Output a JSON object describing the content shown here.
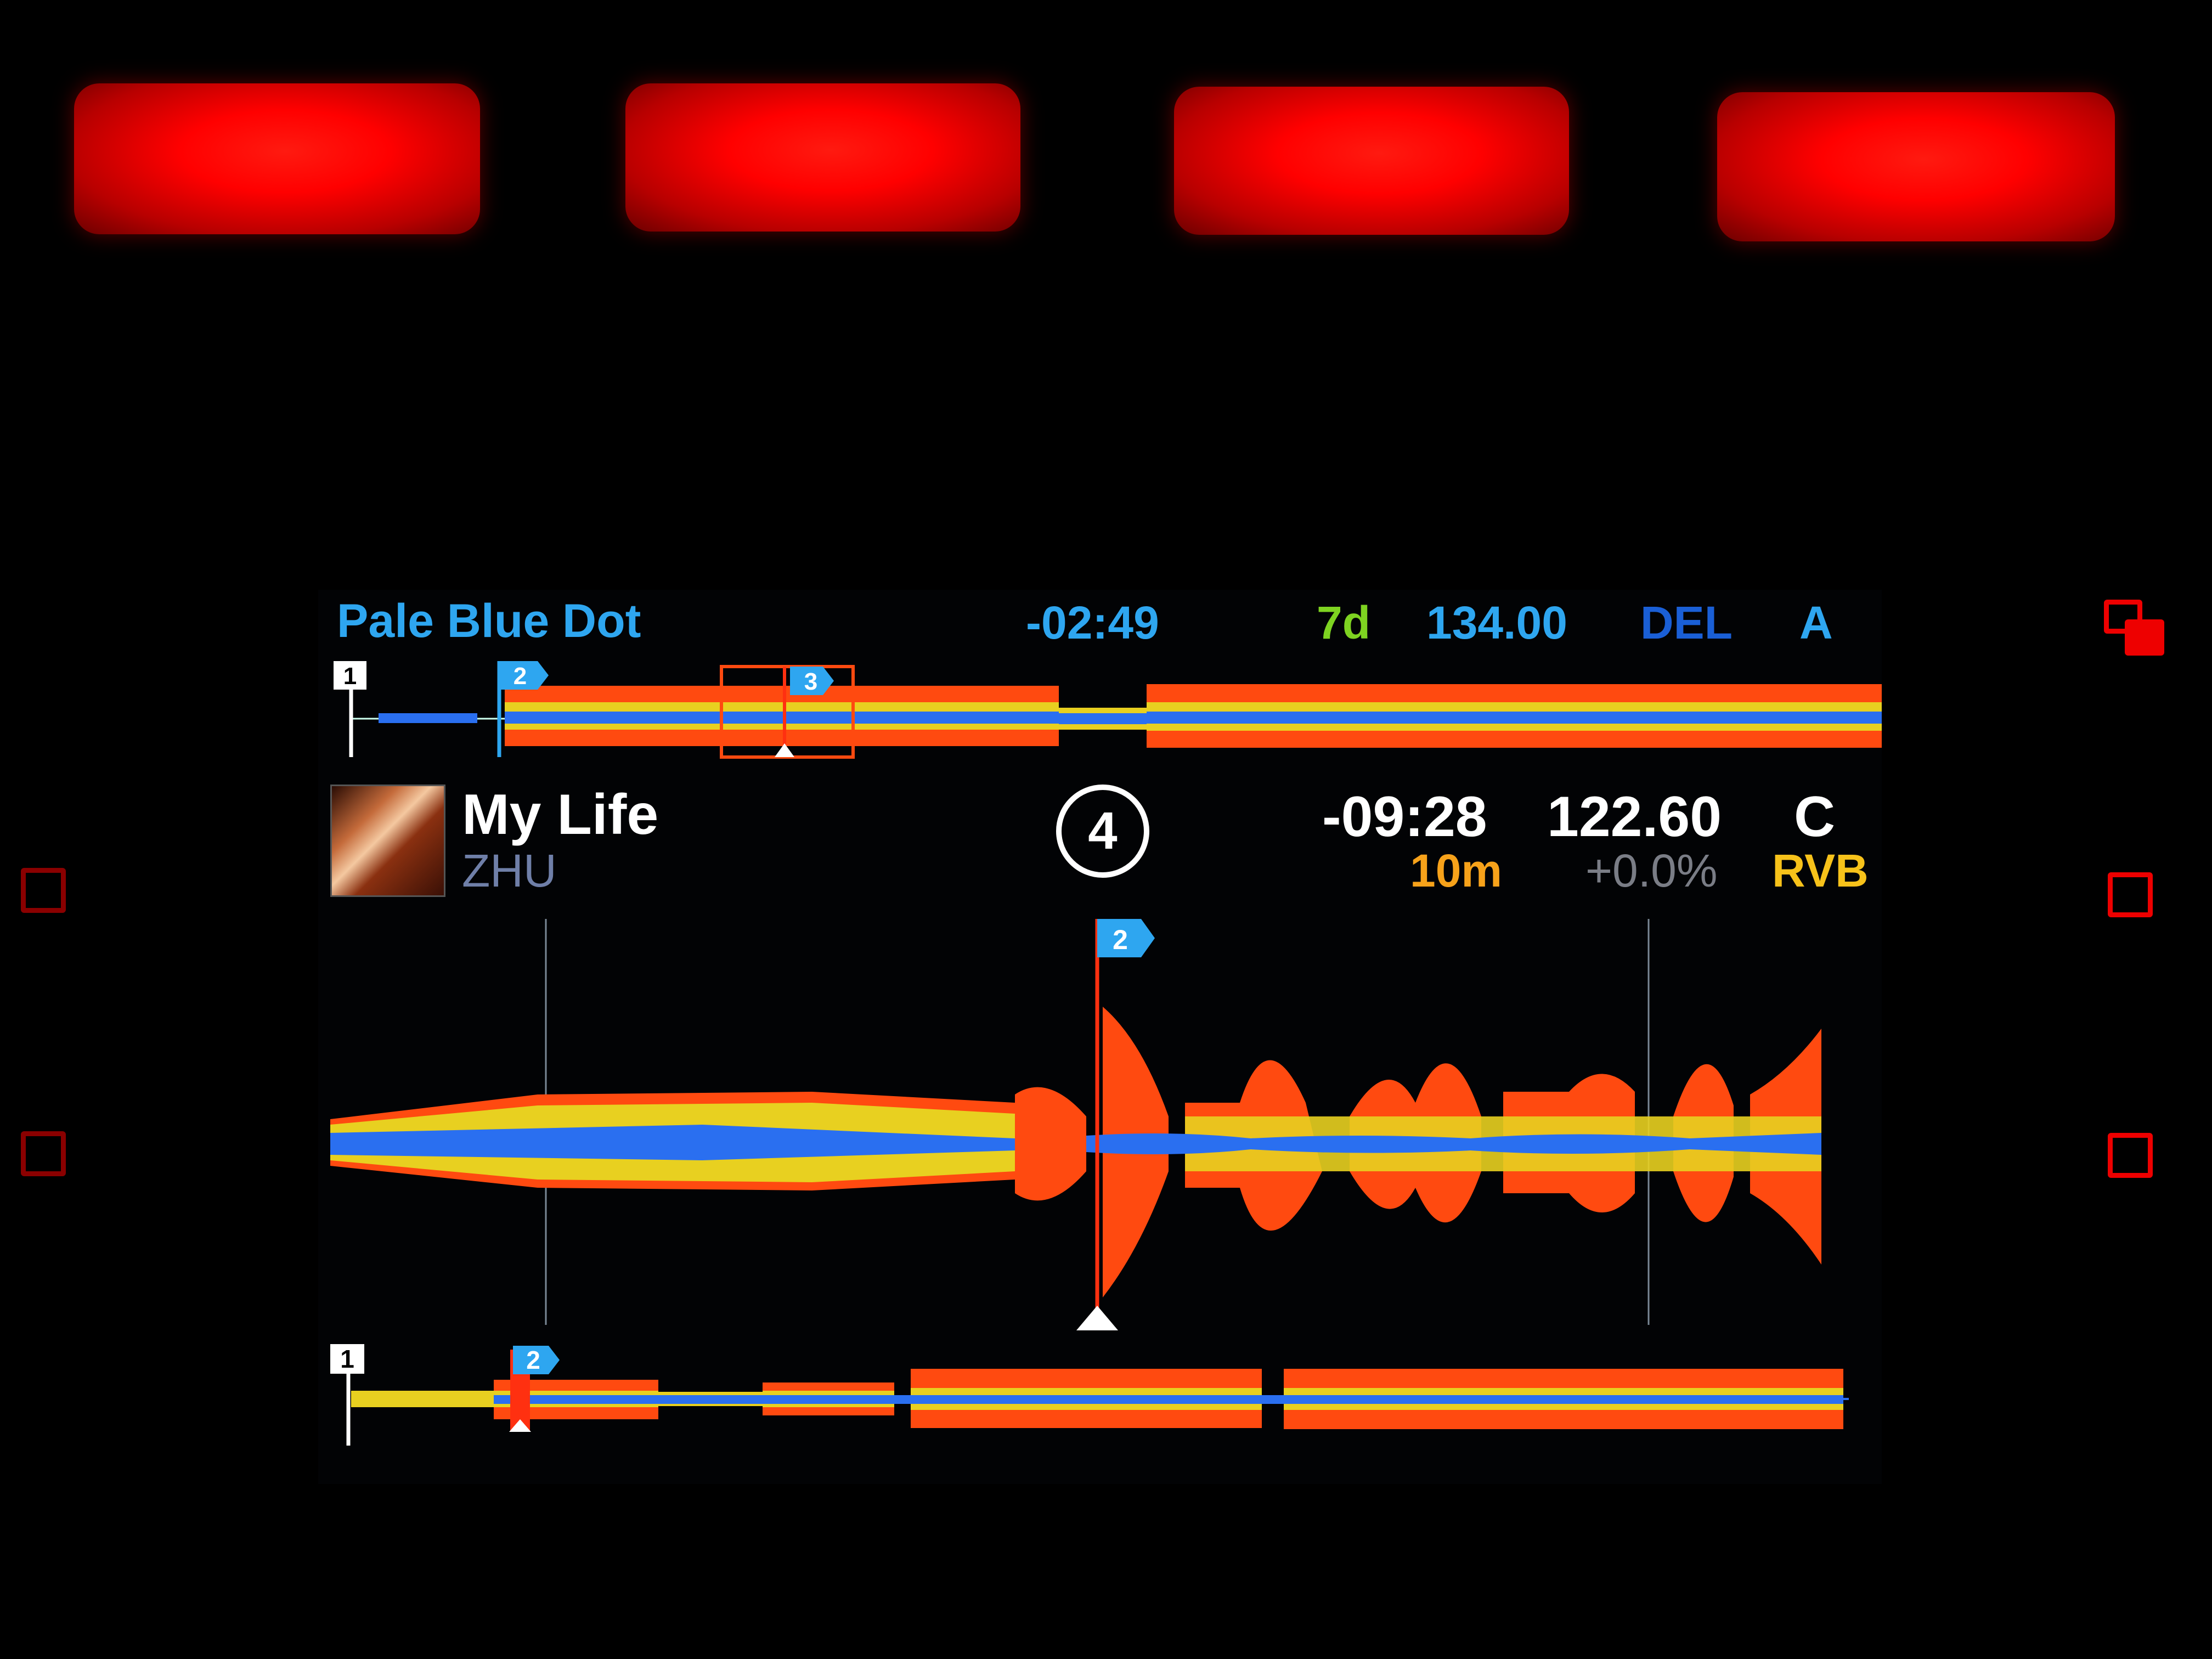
{
  "pads": [
    "pad-1",
    "pad-2",
    "pad-3",
    "pad-4"
  ],
  "deck_a": {
    "title": "Pale Blue Dot",
    "remaining_time": "-02:49",
    "key": "7d",
    "bpm": "134.00",
    "fx": "DEL",
    "deck_letter": "A",
    "cues": [
      "1",
      "2",
      "3"
    ]
  },
  "deck_c": {
    "title": "My Life",
    "artist": "ZHU",
    "beat_counter": "4",
    "remaining_time": "-09:28",
    "bpm": "122.60",
    "deck_letter": "C",
    "key": "10m",
    "pitch": "+0.0%",
    "fx": "RVB",
    "zoom_cue": "2",
    "overview_cues": [
      "1",
      "2"
    ]
  },
  "colors": {
    "accent_blue": "#2ea6f0",
    "key_green": "#7ed321",
    "key_orange": "#f7a21a",
    "wave_orange": "#ff4a10",
    "wave_yellow": "#e8d020",
    "wave_blue": "#2a6ff0",
    "pad_red": "#ff0000"
  },
  "icons": [
    "layers-icon",
    "square-button-icon"
  ]
}
